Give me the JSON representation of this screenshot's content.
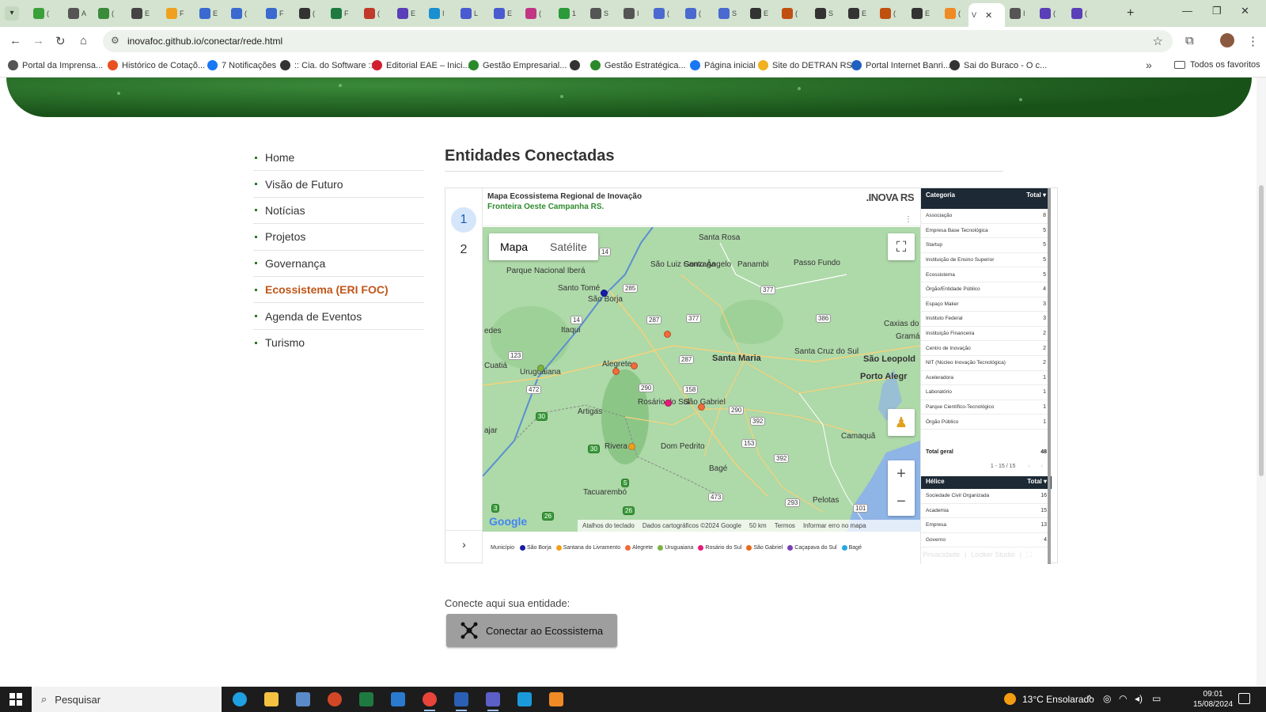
{
  "browser": {
    "active_tab_title": "V",
    "tab_titles": [
      "(",
      "A",
      "(",
      "E",
      "F",
      "E",
      "(",
      "F",
      "(",
      "F",
      "(",
      "E",
      "I",
      "L",
      "E",
      "(",
      "1",
      "S",
      "I",
      "(",
      "(",
      "S",
      "E",
      "(",
      "S",
      "E",
      "(",
      "E",
      "(",
      "I",
      "(",
      "("
    ],
    "url": "inovafoc.github.io/conectar/rede.html",
    "bookmarks": [
      {
        "label": "Portal da Imprensa...",
        "color": "#555555"
      },
      {
        "label": "Histórico de Cotaçõ...",
        "color": "#e8501f"
      },
      {
        "label": "7 Notificações",
        "color": "#1877f2"
      },
      {
        "label": ":: Cia. do Software ::",
        "color": "#333333"
      },
      {
        "label": "Editorial EAE – Inici...",
        "color": "#d02030"
      },
      {
        "label": "Gestão Empresarial...",
        "color": "#2a8a2a"
      },
      {
        "label": "",
        "color": "#333333"
      },
      {
        "label": "Gestão Estratégica...",
        "color": "#2a8a2a"
      },
      {
        "label": "Página inicial",
        "color": "#1877f2"
      },
      {
        "label": "Site do DETRAN RS",
        "color": "#f0b020"
      },
      {
        "label": "Portal Internet Banri...",
        "color": "#2060c0"
      },
      {
        "label": "Sai do Buraco - O c...",
        "color": "#333333"
      }
    ],
    "all_bookmarks_label": "Todos os favoritos"
  },
  "nav": {
    "items": [
      {
        "label": "Home",
        "active": false
      },
      {
        "label": "Visão de Futuro",
        "active": false
      },
      {
        "label": "Notícias",
        "active": false
      },
      {
        "label": "Projetos",
        "active": false
      },
      {
        "label": "Governança",
        "active": false
      },
      {
        "label": "Ecossistema (ERI FOC)",
        "active": true
      },
      {
        "label": "Agenda de Eventos",
        "active": false
      },
      {
        "label": "Turismo",
        "active": false
      }
    ]
  },
  "main": {
    "title": "Entidades Conectadas",
    "cta_label": "Conecte aqui sua entidade:",
    "cta_button": "Conectar ao Ecossistema"
  },
  "report": {
    "pages": [
      "1",
      "2"
    ],
    "current_page": "1",
    "title_line1": "Mapa Ecossistema Regional de Inovação",
    "title_line2": "Fronteira Oeste Campanha RS.",
    "brand": ".INOVA RS",
    "map": {
      "type_map": "Mapa",
      "type_satellite": "Satélite",
      "google": "Google",
      "attribution": [
        "Atalhos do teclado",
        "Dados cartográficos ©2024 Google",
        "50 km",
        "Termos",
        "Informar erro no mapa"
      ],
      "places": [
        {
          "name": "Santa Rosa",
          "big": false
        },
        {
          "name": "São Luiz Gonzaga",
          "big": false
        },
        {
          "name": "Santo Ângelo",
          "big": false
        },
        {
          "name": "Panambi",
          "big": false
        },
        {
          "name": "Passo Fundo",
          "big": false
        },
        {
          "name": "Parque Nacional Iberá",
          "big": false
        },
        {
          "name": "Santo Tomé",
          "big": false
        },
        {
          "name": "São Borja",
          "big": false
        },
        {
          "name": "Itaqui",
          "big": false
        },
        {
          "name": "Caxias do Su",
          "big": false
        },
        {
          "name": "Gramá",
          "big": false
        },
        {
          "name": "Santa Maria",
          "big": true
        },
        {
          "name": "Santa Cruz do Sul",
          "big": false
        },
        {
          "name": "São Leopold",
          "big": true
        },
        {
          "name": "Porto Alegr",
          "big": true
        },
        {
          "name": "Alegrete",
          "big": false
        },
        {
          "name": "Cuatiá",
          "big": false
        },
        {
          "name": "Uruguaiana",
          "big": false
        },
        {
          "name": "Rosário do Sul",
          "big": false
        },
        {
          "name": "São Gabriel",
          "big": false
        },
        {
          "name": "Artigas",
          "big": false
        },
        {
          "name": "Rivera",
          "big": false
        },
        {
          "name": "Dom Pedrito",
          "big": false
        },
        {
          "name": "Camaquã",
          "big": false
        },
        {
          "name": "Bagé",
          "big": false
        },
        {
          "name": "Tacuarembó",
          "big": false
        },
        {
          "name": "Pelotas",
          "big": false
        },
        {
          "name": "edes",
          "big": false
        },
        {
          "name": "ajar",
          "big": false
        }
      ],
      "roads": [
        {
          "label": "14",
          "type": "w"
        },
        {
          "label": "285",
          "type": "w"
        },
        {
          "label": "377",
          "type": "w"
        },
        {
          "label": "287",
          "type": "w"
        },
        {
          "label": "377",
          "type": "w"
        },
        {
          "label": "386",
          "type": "w"
        },
        {
          "label": "14",
          "type": "w"
        },
        {
          "label": "123",
          "type": "w"
        },
        {
          "label": "287",
          "type": "w"
        },
        {
          "label": "472",
          "type": "w"
        },
        {
          "label": "290",
          "type": "w"
        },
        {
          "label": "158",
          "type": "w"
        },
        {
          "label": "290",
          "type": "w"
        },
        {
          "label": "392",
          "type": "w"
        },
        {
          "label": "30",
          "type": "g"
        },
        {
          "label": "30",
          "type": "g"
        },
        {
          "label": "153",
          "type": "w"
        },
        {
          "label": "392",
          "type": "w"
        },
        {
          "label": "5",
          "type": "g"
        },
        {
          "label": "473",
          "type": "w"
        },
        {
          "label": "293",
          "type": "w"
        },
        {
          "label": "26",
          "type": "g"
        },
        {
          "label": "3",
          "type": "g"
        },
        {
          "label": "26",
          "type": "g"
        },
        {
          "label": "101",
          "type": "w"
        }
      ],
      "markers": [
        {
          "name": "São Borja",
          "color": "#1a1aa8"
        },
        {
          "name": "Alegrete",
          "color": "#f26b3a"
        },
        {
          "name": "Alegrete",
          "color": "#f26b3a"
        },
        {
          "name": "Alegrete",
          "color": "#f26b3a"
        },
        {
          "name": "Rosário do Sul",
          "color": "#e6197a"
        },
        {
          "name": "São Gabriel",
          "color": "#f26b3a"
        },
        {
          "name": "Rivera",
          "color": "#f0a020"
        },
        {
          "name": "Uruguaiana",
          "color": "#7cb342"
        }
      ]
    },
    "legend": {
      "title": "Município",
      "items": [
        {
          "label": "São Borja",
          "color": "#1a1aa8"
        },
        {
          "label": "Santana do Livramento",
          "color": "#f0a020"
        },
        {
          "label": "Alegrete",
          "color": "#f26b3a"
        },
        {
          "label": "Uruguaiana",
          "color": "#7cb342"
        },
        {
          "label": "Rosário do Sul",
          "color": "#e6197a"
        },
        {
          "label": "São Gabriel",
          "color": "#e86a1a"
        },
        {
          "label": "Caçapava do Sul",
          "color": "#7b3fb8"
        },
        {
          "label": "Bagé",
          "color": "#29a8e0"
        }
      ]
    },
    "category_table": {
      "headers": [
        "Categoria",
        "Total"
      ],
      "rows": [
        {
          "name": "Associação",
          "total": "8"
        },
        {
          "name": "Empresa Base Tecnológica",
          "total": "5"
        },
        {
          "name": "Startup",
          "total": "5"
        },
        {
          "name": "Instituição de Ensino Superior",
          "total": "5"
        },
        {
          "name": "Ecossistema",
          "total": "5"
        },
        {
          "name": "Órgão/Entidade Público",
          "total": "4"
        },
        {
          "name": "Espaço Maker",
          "total": "3"
        },
        {
          "name": "Instituto Federal",
          "total": "3"
        },
        {
          "name": "Instituição Financeira",
          "total": "2"
        },
        {
          "name": "Centro de Inovação",
          "total": "2"
        },
        {
          "name": "NIT (Núcleo Inovação Tecnológica)",
          "total": "2"
        },
        {
          "name": "Aceleradora",
          "total": "1"
        },
        {
          "name": "Laboratório",
          "total": "1"
        },
        {
          "name": "Parque Científico-Tecnológico",
          "total": "1"
        },
        {
          "name": "Órgão Público",
          "total": "1"
        }
      ],
      "total_label": "Total geral",
      "total_value": "48",
      "pager": "1 - 15 / 15"
    },
    "helix_table": {
      "headers": [
        "Hélice",
        "Total"
      ],
      "rows": [
        {
          "name": "Sociedade Civil Organizada",
          "total": "16"
        },
        {
          "name": "Academia",
          "total": "15"
        },
        {
          "name": "Empresa",
          "total": "13"
        },
        {
          "name": "Governo",
          "total": "4"
        }
      ]
    },
    "footer_links": [
      "Privacidade",
      "Looker Studio"
    ]
  },
  "taskbar": {
    "search_placeholder": "Pesquisar",
    "weather": "13°C Ensolarado",
    "time": "09:01",
    "date": "15/08/2024"
  }
}
